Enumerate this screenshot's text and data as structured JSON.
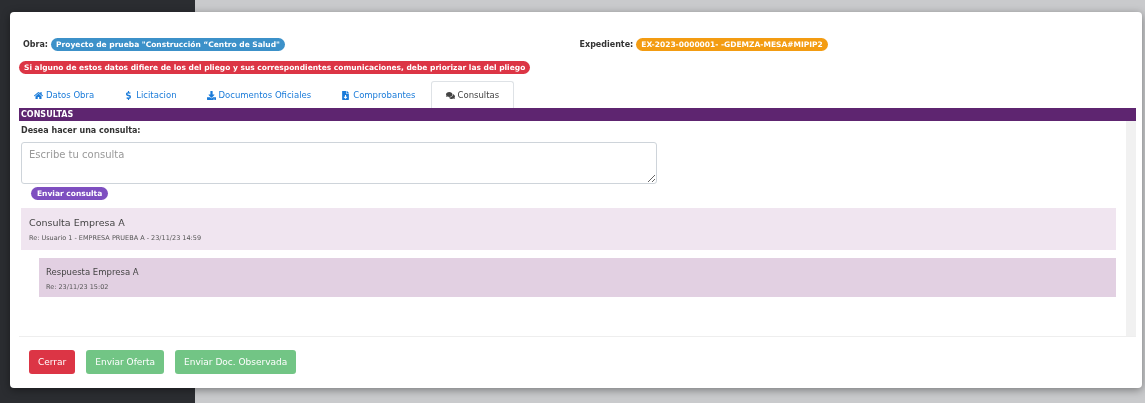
{
  "header": {
    "obra_label": "Obra:",
    "obra": "Proyecto de prueba \"Construcción “Centro de Salud\"",
    "expediente_label": "Expediente:",
    "expediente": "EX-2023-0000001- -GDEMZA-MESA#MIPIP2"
  },
  "warning": "Si alguno de estos datos difiere de los del pliego y sus correspondientes comunicaciones, debe priorizar las del pliego",
  "tabs": [
    {
      "label": "Datos Obra",
      "kind": "home",
      "selected": false
    },
    {
      "label": "Licitacion",
      "kind": "dollar",
      "selected": false
    },
    {
      "label": "Documentos Oficiales",
      "kind": "download",
      "selected": false
    },
    {
      "label": "Comprobantes",
      "kind": "file",
      "selected": false
    },
    {
      "label": "Consultas",
      "kind": "comments",
      "selected": true
    }
  ],
  "section_title": "CONSULTAS",
  "form": {
    "label": "Desea hacer una consulta:",
    "placeholder": "Escribe tu consulta",
    "submit": "Enviar consulta"
  },
  "consultas": [
    {
      "title": "Consulta Empresa A",
      "meta": "Re: Usuario 1 - EMPRESA PRUEBA A - 23/11/23 14:59",
      "children": [
        {
          "title": "Respuesta Empresa A",
          "meta": "Re: 23/11/23 15:02"
        }
      ]
    }
  ],
  "buttons": [
    {
      "label": "Cerrar",
      "kind": "danger",
      "disabled": false
    },
    {
      "label": "Enviar Oferta",
      "kind": "success",
      "disabled": true
    },
    {
      "label": "Enviar Doc. Observada",
      "kind": "success",
      "disabled": true
    }
  ]
}
